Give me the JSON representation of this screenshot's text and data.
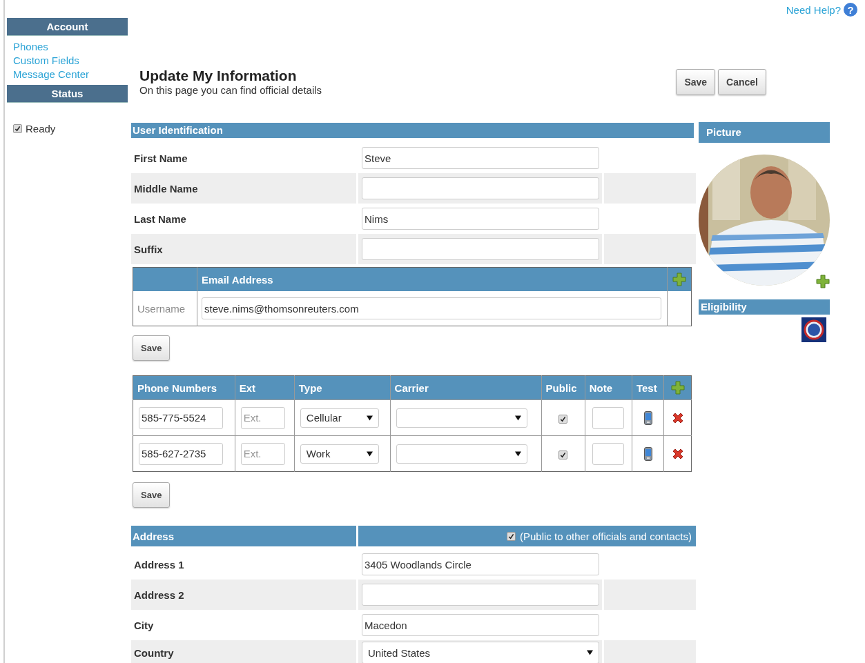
{
  "help": {
    "label": "Need Help?",
    "icon": "?"
  },
  "sidebar": {
    "account_title": "Account",
    "links": [
      "Phones",
      "Custom Fields",
      "Message Center"
    ],
    "status_title": "Status",
    "status": {
      "label": "Ready",
      "checked": true
    }
  },
  "page": {
    "title": "Update My Information",
    "subtitle": "On this page you can find official details"
  },
  "header_buttons": [
    "Save",
    "Cancel"
  ],
  "user_identification": {
    "title": "User Identification",
    "fields": [
      {
        "label": "First Name",
        "value": "Steve"
      },
      {
        "label": "Middle Name"
      },
      {
        "label": "Last Name",
        "value": "Nims"
      },
      {
        "label": "Suffix"
      }
    ]
  },
  "email": {
    "column": "Email Address",
    "rows": [
      {
        "label": "Username",
        "value": "steve.nims@thomsonreuters.com"
      }
    ],
    "save": "Save"
  },
  "phones": {
    "columns": [
      "Phone Numbers",
      "Ext",
      "Type",
      "Carrier",
      "Public",
      "Note",
      "Test"
    ],
    "rows": [
      {
        "number": "585-775-5524",
        "ext_placeholder": "Ext.",
        "type": "Cellular",
        "public": true
      },
      {
        "number": "585-627-2735",
        "ext_placeholder": "Ext.",
        "type": "Work",
        "public": true
      }
    ],
    "save": "Save"
  },
  "address": {
    "title": "Address",
    "public": {
      "label": "(Public to other officials and contacts)",
      "checked": true
    },
    "fields": [
      {
        "label": "Address 1",
        "kind": "text",
        "value": "3405 Woodlands Circle"
      },
      {
        "label": "Address 2",
        "kind": "text"
      },
      {
        "label": "City",
        "kind": "text",
        "value": "Macedon"
      },
      {
        "label": "Country",
        "kind": "select",
        "value": "United States"
      }
    ]
  },
  "picture": {
    "title": "Picture"
  },
  "eligibility": {
    "title": "Eligibility"
  }
}
